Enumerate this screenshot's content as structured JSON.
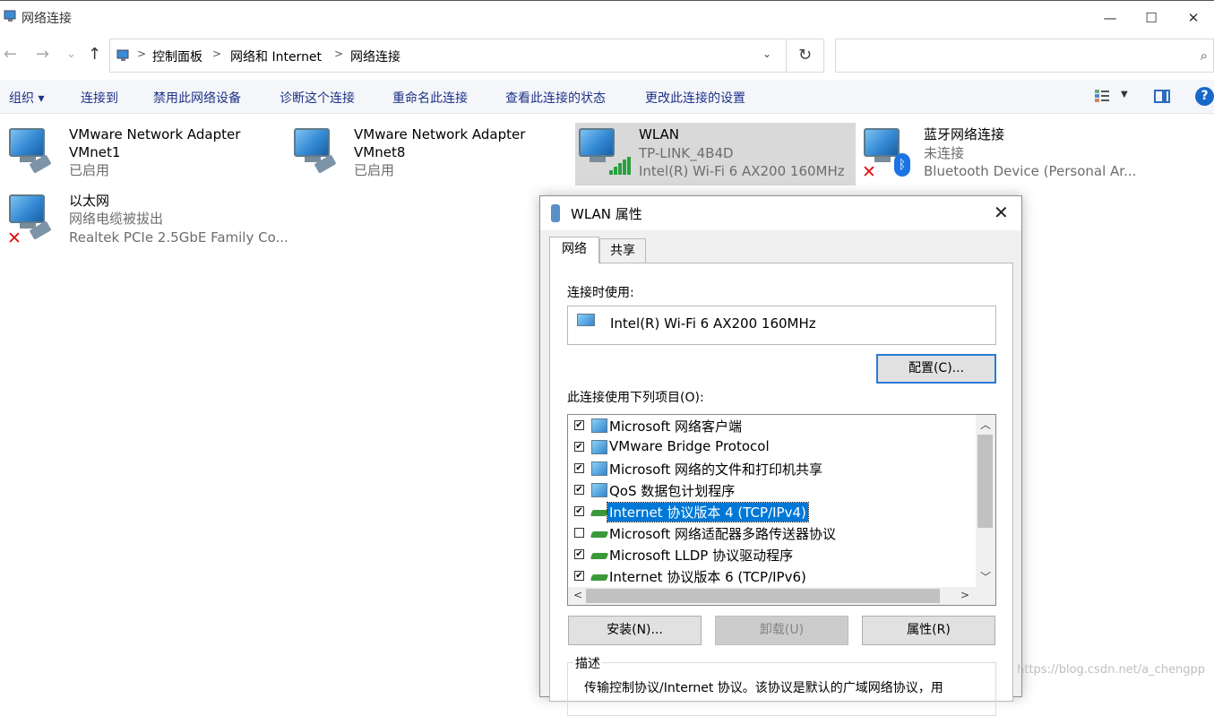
{
  "window": {
    "title": "网络连接",
    "controls": {
      "minimize": "—",
      "maximize": "☐",
      "close": "✕"
    }
  },
  "nav": {
    "back": "←",
    "forward": "→",
    "recent": "⌄",
    "up": "↑",
    "refresh": "↻",
    "dropdown": "⌄",
    "search_icon": "⌕"
  },
  "breadcrumb": [
    "控制面板",
    "网络和 Internet",
    "网络连接"
  ],
  "search": {
    "placeholder": ""
  },
  "commands": {
    "organize": "组织 ▾",
    "connect_to": "连接到",
    "disable": "禁用此网络设备",
    "diagnose": "诊断这个连接",
    "rename": "重命名此连接",
    "view_status": "查看此连接的状态",
    "change_settings": "更改此连接的设置",
    "view_drop": "▼",
    "help": "?"
  },
  "connections": [
    {
      "name": "VMware Network Adapter",
      "line2": "VMnet1",
      "line3": "已启用",
      "status": "enabled",
      "icon": "ethernet-icon"
    },
    {
      "name": "VMware Network Adapter",
      "line2": "VMnet8",
      "line3": "已启用",
      "status": "enabled",
      "icon": "ethernet-icon"
    },
    {
      "name": "WLAN",
      "line2": "TP-LINK_4B4D",
      "line3": "Intel(R) Wi-Fi 6 AX200 160MHz",
      "status": "connected",
      "icon": "wifi-signal-icon"
    },
    {
      "name": "蓝牙网络连接",
      "line2": "未连接",
      "line3": "Bluetooth Device (Personal Ar...",
      "status": "disconnected",
      "icon": "bluetooth-icon"
    },
    {
      "name": "以太网",
      "line2": "网络电缆被拔出",
      "line3": "Realtek PCIe 2.5GbE Family Co...",
      "status": "unplugged",
      "icon": "ethernet-icon"
    }
  ],
  "dialog": {
    "title": "WLAN 属性",
    "close": "✕",
    "tabs": [
      "网络",
      "共享"
    ],
    "connect_using_label": "连接时使用:",
    "adapter": "Intel(R) Wi-Fi 6 AX200 160MHz",
    "configure_button": "配置(C)...",
    "items_label": "此连接使用下列项目(O):",
    "items": [
      {
        "label": "Microsoft 网络客户端",
        "checked": true,
        "icon": "client-icon"
      },
      {
        "label": "VMware Bridge Protocol",
        "checked": true,
        "icon": "client-icon"
      },
      {
        "label": "Microsoft 网络的文件和打印机共享",
        "checked": true,
        "icon": "client-icon"
      },
      {
        "label": "QoS 数据包计划程序",
        "checked": true,
        "icon": "client-icon"
      },
      {
        "label": "Internet 协议版本 4 (TCP/IPv4)",
        "checked": true,
        "icon": "protocol-icon",
        "selected": true
      },
      {
        "label": "Microsoft 网络适配器多路传送器协议",
        "checked": false,
        "icon": "protocol-icon"
      },
      {
        "label": "Microsoft LLDP 协议驱动程序",
        "checked": true,
        "icon": "protocol-icon"
      },
      {
        "label": "Internet 协议版本 6 (TCP/IPv6)",
        "checked": true,
        "icon": "protocol-icon"
      }
    ],
    "install_button": "安装(N)...",
    "uninstall_button": "卸载(U)",
    "properties_button": "属性(R)",
    "description_label": "描述",
    "description_text": "传输控制协议/Internet 协议。该协议是默认的广域网络协议，用"
  },
  "watermark": "https://blog.csdn.net/a_chengpp",
  "colors": {
    "accent": "#0078d7",
    "command_text": "#1e3287",
    "wifi_green": "#27a13d",
    "error_red": "#e01010",
    "bluetooth": "#1b74e4"
  }
}
